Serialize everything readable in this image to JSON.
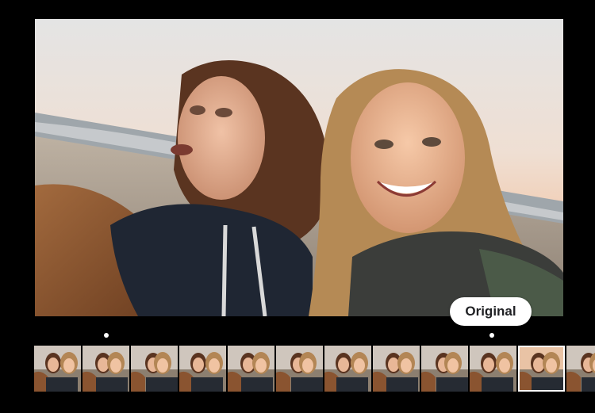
{
  "viewer": {
    "original_label": "Original"
  },
  "filmstrip": {
    "frame_count": 12,
    "selected_index": 10
  },
  "colors": {
    "background": "#000000",
    "chip_background": "#ffffff",
    "chip_text": "#202124"
  }
}
